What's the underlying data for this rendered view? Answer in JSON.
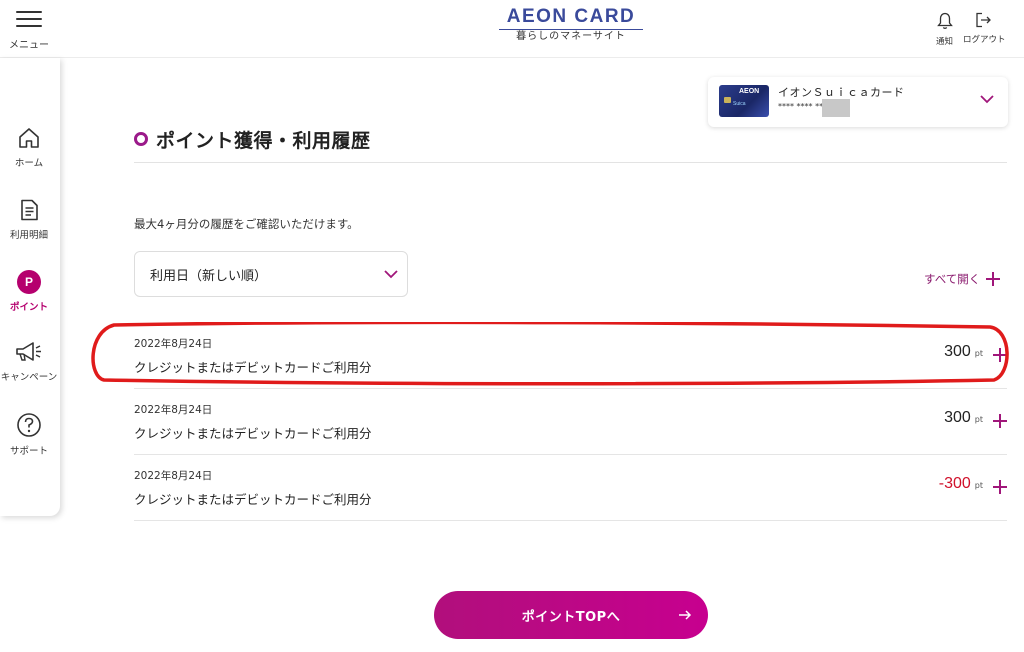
{
  "header": {
    "menu_label": "メニュー",
    "logo_main": "AEON CARD",
    "logo_sub": "暮らしのマネーサイト",
    "notify_label": "通知",
    "logout_label": "ログアウト"
  },
  "sidebar": {
    "items": [
      {
        "label": "ホーム",
        "icon": "home-icon"
      },
      {
        "label": "利用明細",
        "icon": "document-icon"
      },
      {
        "label": "ポイント",
        "icon": "point-icon",
        "active": true,
        "badge": "P"
      },
      {
        "label": "キャンペーン",
        "icon": "megaphone-icon"
      },
      {
        "label": "サポート",
        "icon": "help-icon"
      }
    ]
  },
  "card": {
    "name": "イオンＳｕｉｃａカード",
    "number": "**** **** ****",
    "thumb_brand": "AEON",
    "thumb_sub": "Suica"
  },
  "page": {
    "title": "ポイント獲得・利用履歴",
    "description": "最大4ヶ月分の履歴をご確認いただけます。",
    "sort_value": "利用日（新しい順）",
    "expand_all_label": "すべて開く"
  },
  "history": [
    {
      "date": "2022年8月24日",
      "description": "クレジットまたはデビットカードご利用分",
      "amount": "300",
      "unit": "pt",
      "negative": false
    },
    {
      "date": "2022年8月24日",
      "description": "クレジットまたはデビットカードご利用分",
      "amount": "300",
      "unit": "pt",
      "negative": false
    },
    {
      "date": "2022年8月24日",
      "description": "クレジットまたはデビットカードご利用分",
      "amount": "-300",
      "unit": "pt",
      "negative": true
    }
  ],
  "bottom_button": {
    "label": "ポイントTOPへ"
  },
  "colors": {
    "accent": "#b5006e",
    "logo_blue": "#3a4a9b",
    "negative": "#d0102a",
    "annotation_red": "#e01b1b"
  }
}
